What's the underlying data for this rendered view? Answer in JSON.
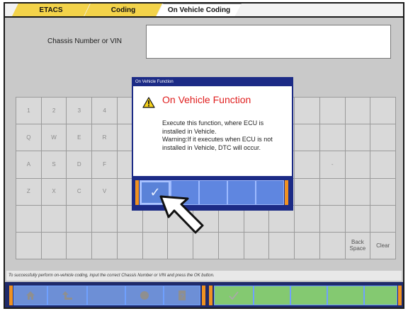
{
  "tabs": [
    {
      "label": "ETACS"
    },
    {
      "label": "Coding"
    },
    {
      "label": "On Vehicle Coding"
    }
  ],
  "vin": {
    "label": "Chassis Number or VIN",
    "value": ""
  },
  "keyboard": {
    "rows": [
      [
        "1",
        "2",
        "3",
        "4",
        "",
        "",
        "",
        "",
        "",
        "",
        "",
        "",
        "",
        "",
        ""
      ],
      [
        "Q",
        "W",
        "E",
        "R",
        "",
        "",
        "",
        "",
        "",
        "",
        "",
        "",
        "",
        "",
        ""
      ],
      [
        "A",
        "S",
        "D",
        "F",
        "",
        "",
        "",
        "",
        "",
        "",
        "",
        "",
        "-",
        "",
        ""
      ],
      [
        "Z",
        "X",
        "C",
        "V",
        "",
        "",
        "",
        "",
        "",
        "",
        "",
        "",
        "",
        "",
        ""
      ],
      [
        "",
        "",
        "",
        "",
        "",
        "",
        "",
        "",
        "",
        "",
        "",
        "",
        "",
        "",
        ""
      ],
      [
        "",
        "",
        "",
        "",
        "",
        "",
        "",
        "",
        "",
        "",
        "",
        "",
        "",
        "Back Space",
        "Clear"
      ]
    ]
  },
  "status": {
    "text": "To successfully perform on-vehicle coding, input the correct Chassis Number or VIN and press the OK button."
  },
  "toolbar": {
    "left_icons": [
      "home-icon",
      "back-arrow-icon",
      "",
      "print-icon",
      "help-icon"
    ],
    "right_icons": [
      "check-icon",
      "",
      "",
      "",
      "",
      ""
    ]
  },
  "dialog": {
    "title": "On Vehicle Function",
    "heading": "On Vehicle Function",
    "message": "Execute this function, where ECU is installed in Vehicle.\nWarning:If it executes when ECU is not installed in Vehicle, DTC will occur.",
    "ok_label": "✓"
  },
  "colors": {
    "tab_active": "#f3d34a",
    "dialog_blue": "#1c2b86",
    "heading_red": "#e02020",
    "toolbar_blue": "#6d8fd6",
    "toolbar_green": "#84c971",
    "accent_orange": "#f09222"
  }
}
